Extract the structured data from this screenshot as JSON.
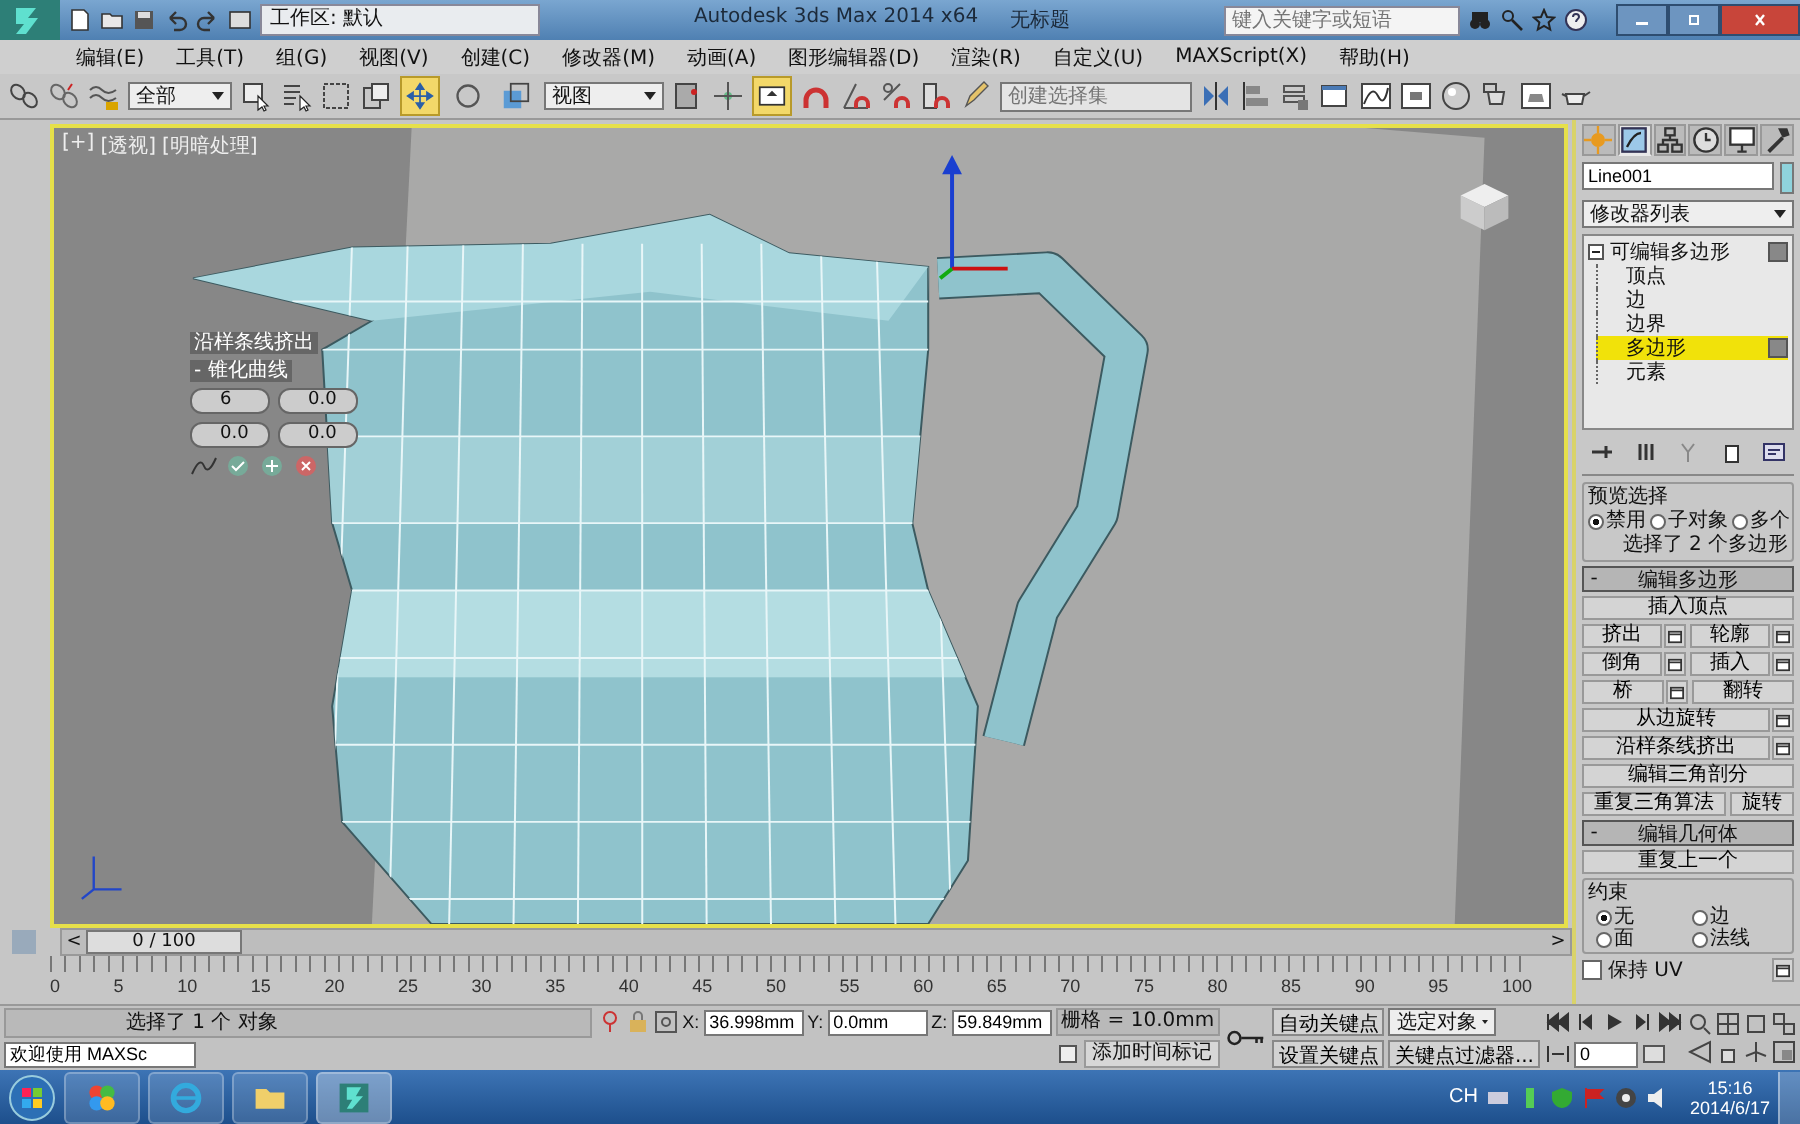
{
  "title_bar": {
    "workspace": "工作区: 默认",
    "app_title": "Autodesk 3ds Max  2014 x64",
    "doc_title": "无标题",
    "search": {
      "placeholder": "键入关键字或短语"
    }
  },
  "menu": [
    "编辑(E)",
    "工具(T)",
    "组(G)",
    "视图(V)",
    "创建(C)",
    "修改器(M)",
    "动画(A)",
    "图形编辑器(D)",
    "渲染(R)",
    "自定义(U)",
    "MAXScript(X)",
    "帮助(H)"
  ],
  "toolbar": {
    "selection_filter": "全部",
    "reference_coord": "视图",
    "named_selection": {
      "placeholder": "创建选择集"
    },
    "transform_tools": [
      {
        "kind": "move",
        "selected": true
      },
      {
        "kind": "rotate",
        "selected": false
      },
      {
        "kind": "scale",
        "selected": false
      }
    ],
    "manipulate": {
      "selected": true
    }
  },
  "viewport": {
    "labels": [
      "[+]",
      "[透视]",
      "[明暗处理]"
    ],
    "caddy": {
      "title": "沿样条线挤出",
      "subtitle": "- 锥化曲线",
      "fields": [
        "6",
        "0.0",
        "0.0",
        "0.0"
      ]
    }
  },
  "command_panel": {
    "tabs": [
      {
        "kind": "create",
        "selected": false
      },
      {
        "kind": "modify",
        "selected": true
      },
      {
        "kind": "hierarchy",
        "selected": false
      },
      {
        "kind": "motion",
        "selected": false
      },
      {
        "kind": "display",
        "selected": false
      },
      {
        "kind": "utilities",
        "selected": false
      }
    ],
    "object_name": "Line001",
    "modifier_list": "修改器列表",
    "stack": {
      "label": "可编辑多边形",
      "expanded": true,
      "children": [
        {
          "label": "顶点",
          "selected": false
        },
        {
          "label": "边",
          "selected": false
        },
        {
          "label": "边界",
          "selected": false
        },
        {
          "label": "多边形",
          "selected": true
        },
        {
          "label": "元素",
          "selected": false
        }
      ]
    },
    "preview_selection": {
      "title": "预览选择",
      "options": [
        {
          "label": "禁用",
          "selected": true
        },
        {
          "label": "子对象",
          "selected": false
        },
        {
          "label": "多个",
          "selected": false
        }
      ],
      "info": "选择了 2 个多边形"
    },
    "edit_polygons": {
      "sign": "-",
      "title": "编辑多边形",
      "rows": [
        [
          {
            "label": "插入顶点",
            "settings": false
          }
        ],
        [
          {
            "label": "挤出",
            "settings": true
          },
          {
            "label": "轮廓",
            "settings": true
          }
        ],
        [
          {
            "label": "倒角",
            "settings": true
          },
          {
            "label": "插入",
            "settings": true
          }
        ],
        [
          {
            "label": "桥",
            "settings": true
          },
          {
            "label": "翻转",
            "settings": false
          }
        ],
        [
          {
            "label": "从边旋转",
            "settings": true
          }
        ],
        [
          {
            "label": "沿样条线挤出",
            "settings": true
          }
        ],
        [
          {
            "label": "编辑三角剖分",
            "settings": false
          }
        ],
        [
          {
            "label": "重复三角算法",
            "settings": false
          },
          {
            "label": "旋转",
            "settings": false
          }
        ]
      ]
    },
    "edit_geometry": {
      "sign": "-",
      "title": "编辑几何体",
      "repeat_last": "重复上一个",
      "constraints": {
        "title": "约束",
        "options": [
          {
            "label": "无",
            "selected": true
          },
          {
            "label": "边",
            "selected": false
          },
          {
            "label": "面",
            "selected": false
          },
          {
            "label": "法线",
            "selected": false
          }
        ]
      },
      "preserve_uv": {
        "label": "保持 UV",
        "checked": false
      }
    }
  },
  "time_slider": {
    "prev": "<",
    "label": "0 / 100",
    "next": ">",
    "level": 0
  },
  "track_bar": {
    "ticks": [
      "0",
      "5",
      "10",
      "15",
      "20",
      "25",
      "30",
      "35",
      "40",
      "45",
      "50",
      "55",
      "60",
      "65",
      "70",
      "75",
      "80",
      "85",
      "90",
      "95",
      "100"
    ]
  },
  "status": {
    "selection": "选择了 1 个 对象",
    "listener": "欢迎使用 MAXSc",
    "coords": [
      {
        "axis": "X:",
        "value": "36.998mm"
      },
      {
        "axis": "Y:",
        "value": "0.0mm"
      },
      {
        "axis": "Z:",
        "value": "59.849mm"
      }
    ],
    "grid": "栅格 = 10.0mm",
    "add_time_tag": "添加时间标记"
  },
  "animation": {
    "auto_key": "自动关键点",
    "key_mode": "选定对象",
    "set_key": "设置关键点",
    "key_filters": "关键点过滤器...",
    "frame": "0"
  },
  "taskbar": {
    "language": "CH",
    "time": "15:16",
    "date": "2014/6/17"
  }
}
